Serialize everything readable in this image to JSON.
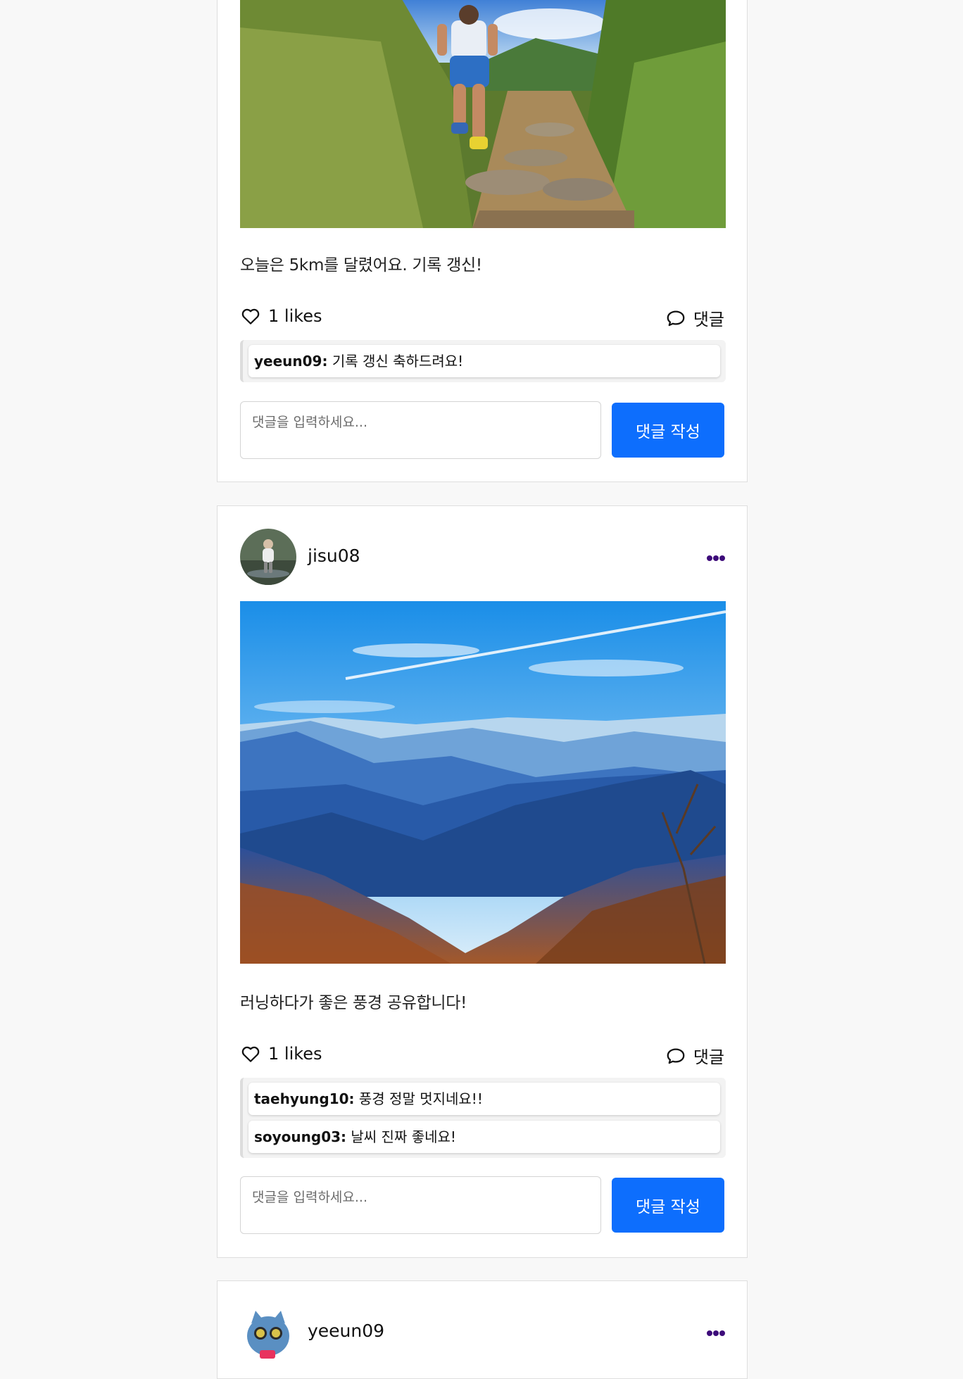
{
  "posts": [
    {
      "caption": "오늘은 5km를 달렸어요. 기록 갱신!",
      "likes_label": "1 likes",
      "comment_label": "댓글",
      "comments": [
        {
          "author": "yeeun09:",
          "text": " 기록 갱신 축하드려요!"
        }
      ],
      "input_placeholder": "댓글을 입력하세요...",
      "submit_label": "댓글 작성"
    },
    {
      "username": "jisu08",
      "caption": "러닝하다가 좋은 풍경 공유합니다!",
      "likes_label": "1 likes",
      "comment_label": "댓글",
      "comments": [
        {
          "author": "taehyung10:",
          "text": " 풍경 정말 멋지네요!!"
        },
        {
          "author": "soyoung03:",
          "text": " 날씨 진짜 좋네요!"
        }
      ],
      "input_placeholder": "댓글을 입력하세요...",
      "submit_label": "댓글 작성"
    },
    {
      "username": "yeeun09"
    }
  ],
  "colors": {
    "accent": "#0d6efd",
    "more_icon": "#3d0a7a",
    "page_bg": "#f8f8f8"
  },
  "icons": {
    "like": "heart-outline-icon",
    "comment": "speech-bubble-icon",
    "more": "three-dots-icon"
  }
}
